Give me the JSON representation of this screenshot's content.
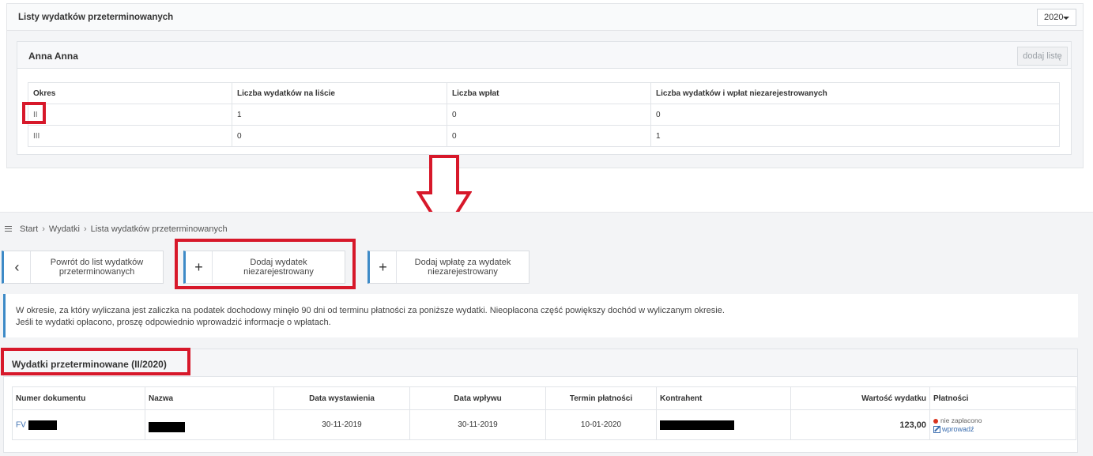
{
  "top": {
    "title": "Listy wydatków przeterminowanych",
    "year": "2020",
    "person": {
      "name": "Anna Anna",
      "add_list_label": "dodaj listę",
      "columns": [
        "Okres",
        "Liczba wydatków na liście",
        "Liczba wpłat",
        "Liczba wydatków i wpłat niezarejestrowanych"
      ],
      "rows": [
        [
          "II",
          "1",
          "0",
          "0"
        ],
        [
          "III",
          "0",
          "0",
          "1"
        ]
      ]
    }
  },
  "breadcrumb": [
    "Start",
    "Wydatki",
    "Lista wydatków przeterminowanych"
  ],
  "actions": {
    "back": {
      "icon": "chevron-left-icon",
      "line1": "Powrót do list wydatków",
      "line2": "przeterminowanych"
    },
    "add_expense": {
      "icon": "plus-icon",
      "line1": "Dodaj wydatek",
      "line2": "niezarejestrowany"
    },
    "add_payment": {
      "icon": "plus-icon",
      "line1": "Dodaj wpłatę za wydatek",
      "line2": "niezarejestrowany"
    }
  },
  "info": {
    "line1": "W okresie, za który wyliczana jest zaliczka na podatek dochodowy minęło 90 dni od terminu płatności za poniższe wydatki. Nieopłacona część powiększy dochód w wyliczanym okresie.",
    "line2": "Jeśli te wydatki opłacono, proszę odpowiednio wprowadzić informacje o wpłatach."
  },
  "overdue": {
    "title": "Wydatki przeterminowane (II/2020)",
    "columns": [
      "Numer dokumentu",
      "Nazwa",
      "Data wystawienia",
      "Data wpływu",
      "Termin płatności",
      "Kontrahent",
      "Wartość wydatku",
      "Płatności"
    ],
    "row": {
      "doc_prefix": "FV",
      "issue_date": "30-11-2019",
      "receipt_date": "30-11-2019",
      "due_date": "10-01-2020",
      "value": "123,00",
      "status": "nie zapłacono",
      "enter_link": "wprowadź"
    }
  },
  "colors": {
    "highlight": "#d7182a",
    "accent": "#3d8ac7",
    "status_unpaid": "#d9341e"
  }
}
